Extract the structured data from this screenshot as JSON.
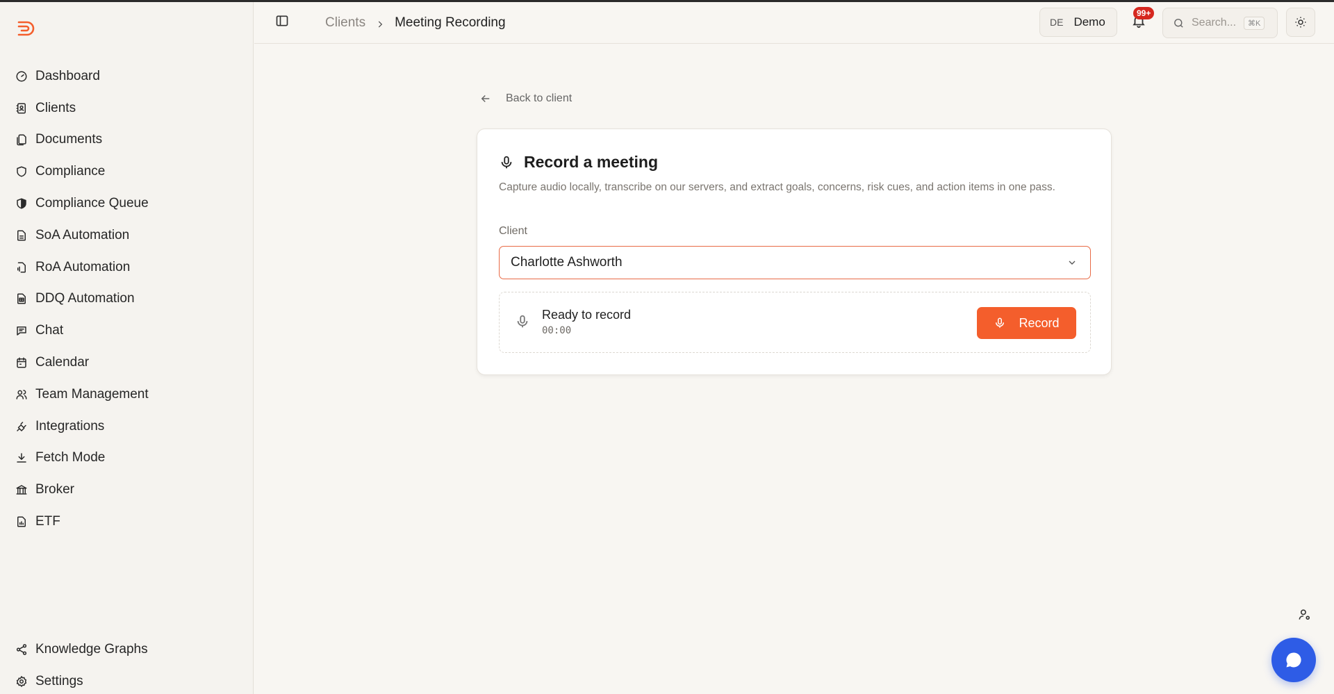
{
  "sidebar": {
    "items": [
      {
        "label": "Dashboard",
        "icon": "gauge-icon"
      },
      {
        "label": "Clients",
        "icon": "contact-book-icon"
      },
      {
        "label": "Documents",
        "icon": "files-icon"
      },
      {
        "label": "Compliance",
        "icon": "shield-icon"
      },
      {
        "label": "Compliance Queue",
        "icon": "shield-half-icon"
      },
      {
        "label": "SoA Automation",
        "icon": "file-text-icon"
      },
      {
        "label": "RoA Automation",
        "icon": "file-audio-icon"
      },
      {
        "label": "DDQ Automation",
        "icon": "file-spreadsheet-icon"
      },
      {
        "label": "Chat",
        "icon": "message-square-icon"
      },
      {
        "label": "Calendar",
        "icon": "calendar-icon"
      },
      {
        "label": "Team Management",
        "icon": "users-icon"
      },
      {
        "label": "Integrations",
        "icon": "plug-icon"
      },
      {
        "label": "Fetch Mode",
        "icon": "download-icon"
      },
      {
        "label": "Broker",
        "icon": "bank-icon"
      },
      {
        "label": "ETF",
        "icon": "file-chart-icon"
      }
    ],
    "bottom_items": [
      {
        "label": "Knowledge Graphs",
        "icon": "share-nodes-icon"
      },
      {
        "label": "Settings",
        "icon": "gear-icon"
      }
    ]
  },
  "header": {
    "breadcrumb_parent": "Clients",
    "breadcrumb_current": "Meeting Recording",
    "lang_code": "DE",
    "workspace": "Demo",
    "notification_count": "99+",
    "search_placeholder": "Search...",
    "search_shortcut": "⌘K"
  },
  "main": {
    "back_label": "Back to client",
    "card_title": "Record a meeting",
    "card_description": "Capture audio locally, transcribe on our servers, and extract goals, concerns, risk cues, and action items in one pass.",
    "client_label": "Client",
    "client_value": "Charlotte Ashworth",
    "recorder_status": "Ready to record",
    "recorder_time": "00:00",
    "record_button": "Record"
  },
  "colors": {
    "accent": "#f45e2c",
    "select_border": "#e86a45",
    "badge": "#d6281f",
    "chat_fab": "#2e5ce6",
    "background": "#f8f6f2"
  }
}
